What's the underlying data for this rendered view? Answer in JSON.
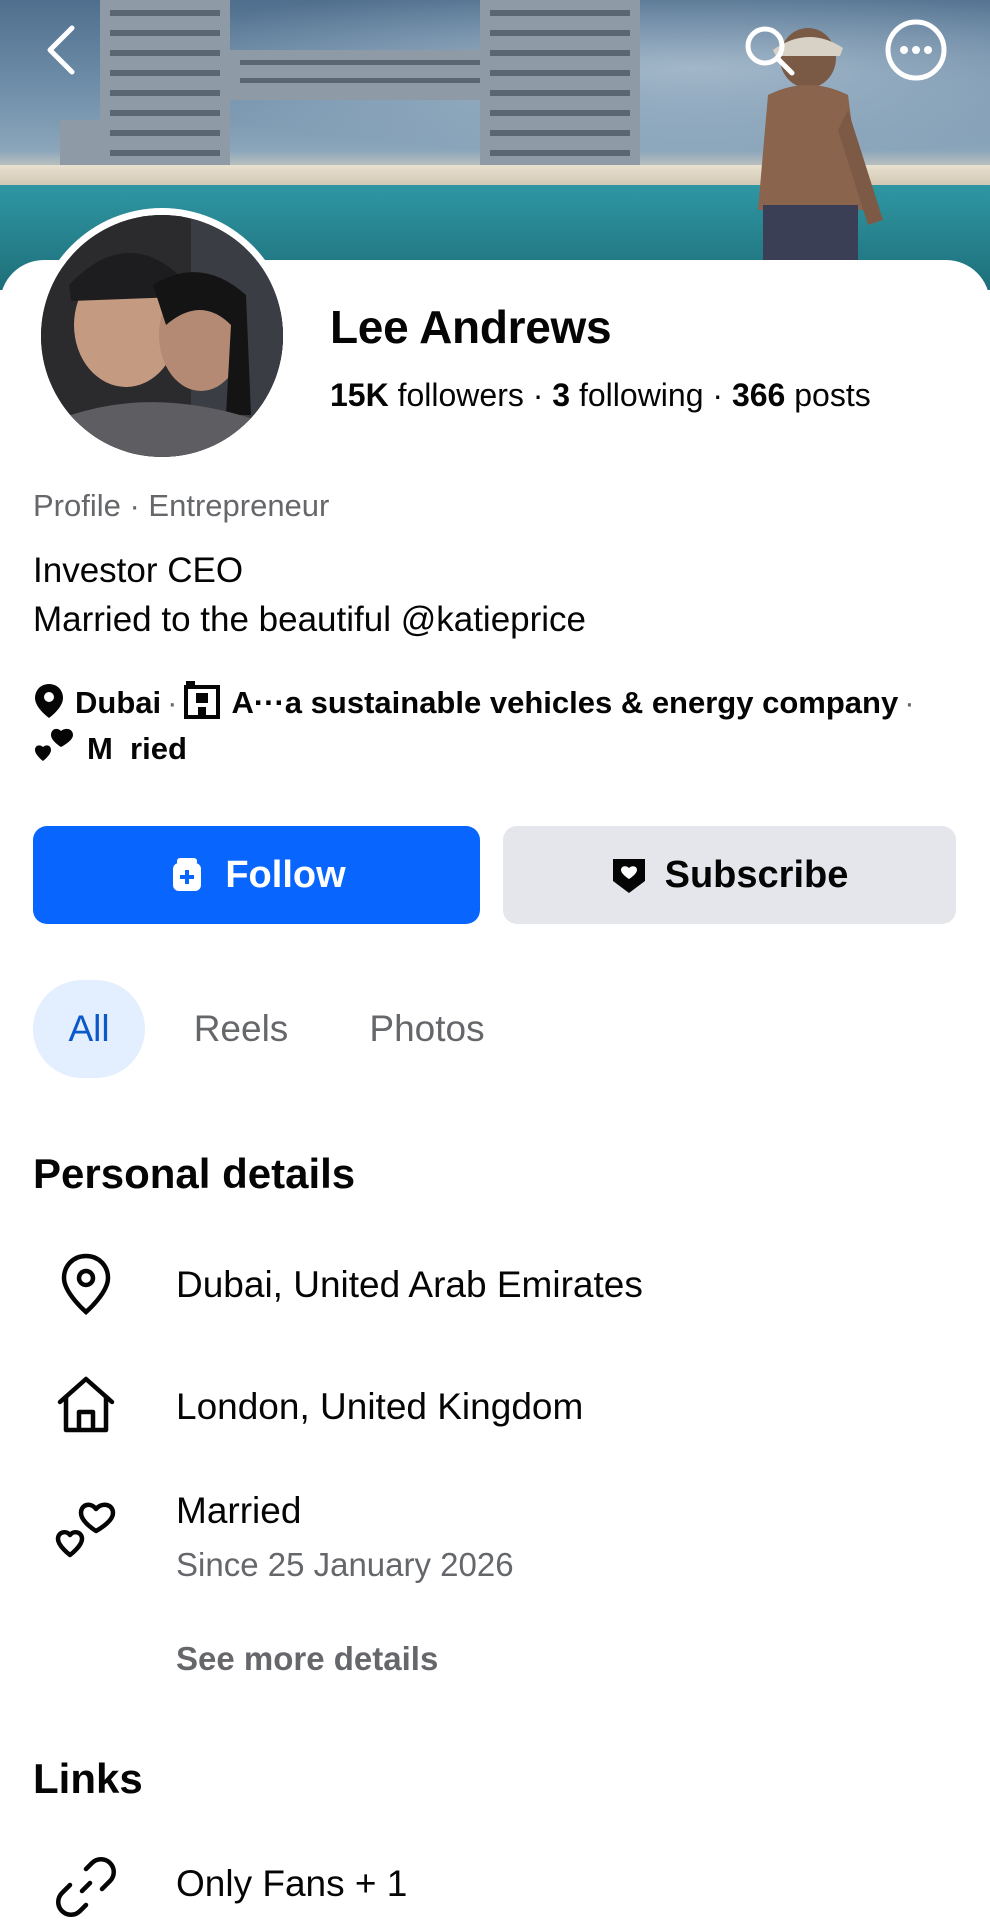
{
  "header": {
    "back_icon": "chevron-left-icon",
    "search_icon": "search-icon",
    "more_icon": "more-horizontal-icon"
  },
  "profile": {
    "name": "Lee Andrews",
    "followers_count": "15K",
    "followers_label": " followers",
    "following_count": "3",
    "following_label": " following",
    "posts_count": "366",
    "posts_label": " posts",
    "dot": " · ",
    "category": "Profile · Entrepreneur",
    "bio_line1": "Investor CEO",
    "bio_line2": "Married to the beautiful @katieprice"
  },
  "meta": {
    "location": "Dubai",
    "work": "A···a sustainable vehicles & energy company",
    "relationship": "M  ried",
    "separator": "·"
  },
  "actions": {
    "follow_label": "Follow",
    "subscribe_label": "Subscribe"
  },
  "tabs": [
    {
      "label": "All",
      "active": true
    },
    {
      "label": "Reels",
      "active": false
    },
    {
      "label": "Photos",
      "active": false
    }
  ],
  "personal_details": {
    "title": "Personal details",
    "current_city": "Dubai, United Arab Emirates",
    "hometown": "London, United Kingdom",
    "relationship": "Married",
    "relationship_since": "Since 25 January 2026",
    "see_more": "See more details"
  },
  "links": {
    "title": "Links",
    "items": [
      {
        "label": "Only Fans + 1"
      }
    ]
  },
  "colors": {
    "primary_blue": "#0866ff",
    "tab_active_bg": "#e3effe",
    "tab_active_text": "#0a58ca",
    "secondary_text": "#65676b",
    "button_grey": "#e4e6eb"
  }
}
